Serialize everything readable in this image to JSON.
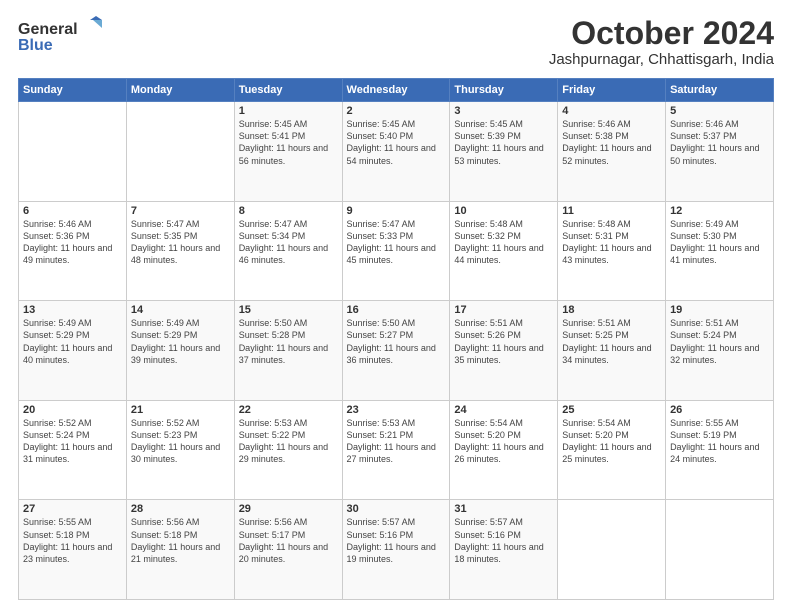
{
  "header": {
    "logo_line1": "General",
    "logo_line2": "Blue",
    "title": "October 2024",
    "subtitle": "Jashpurnagar, Chhattisgarh, India"
  },
  "days_of_week": [
    "Sunday",
    "Monday",
    "Tuesday",
    "Wednesday",
    "Thursday",
    "Friday",
    "Saturday"
  ],
  "weeks": [
    [
      {
        "day": "",
        "info": ""
      },
      {
        "day": "",
        "info": ""
      },
      {
        "day": "1",
        "info": "Sunrise: 5:45 AM\nSunset: 5:41 PM\nDaylight: 11 hours and 56 minutes."
      },
      {
        "day": "2",
        "info": "Sunrise: 5:45 AM\nSunset: 5:40 PM\nDaylight: 11 hours and 54 minutes."
      },
      {
        "day": "3",
        "info": "Sunrise: 5:45 AM\nSunset: 5:39 PM\nDaylight: 11 hours and 53 minutes."
      },
      {
        "day": "4",
        "info": "Sunrise: 5:46 AM\nSunset: 5:38 PM\nDaylight: 11 hours and 52 minutes."
      },
      {
        "day": "5",
        "info": "Sunrise: 5:46 AM\nSunset: 5:37 PM\nDaylight: 11 hours and 50 minutes."
      }
    ],
    [
      {
        "day": "6",
        "info": "Sunrise: 5:46 AM\nSunset: 5:36 PM\nDaylight: 11 hours and 49 minutes."
      },
      {
        "day": "7",
        "info": "Sunrise: 5:47 AM\nSunset: 5:35 PM\nDaylight: 11 hours and 48 minutes."
      },
      {
        "day": "8",
        "info": "Sunrise: 5:47 AM\nSunset: 5:34 PM\nDaylight: 11 hours and 46 minutes."
      },
      {
        "day": "9",
        "info": "Sunrise: 5:47 AM\nSunset: 5:33 PM\nDaylight: 11 hours and 45 minutes."
      },
      {
        "day": "10",
        "info": "Sunrise: 5:48 AM\nSunset: 5:32 PM\nDaylight: 11 hours and 44 minutes."
      },
      {
        "day": "11",
        "info": "Sunrise: 5:48 AM\nSunset: 5:31 PM\nDaylight: 11 hours and 43 minutes."
      },
      {
        "day": "12",
        "info": "Sunrise: 5:49 AM\nSunset: 5:30 PM\nDaylight: 11 hours and 41 minutes."
      }
    ],
    [
      {
        "day": "13",
        "info": "Sunrise: 5:49 AM\nSunset: 5:29 PM\nDaylight: 11 hours and 40 minutes."
      },
      {
        "day": "14",
        "info": "Sunrise: 5:49 AM\nSunset: 5:29 PM\nDaylight: 11 hours and 39 minutes."
      },
      {
        "day": "15",
        "info": "Sunrise: 5:50 AM\nSunset: 5:28 PM\nDaylight: 11 hours and 37 minutes."
      },
      {
        "day": "16",
        "info": "Sunrise: 5:50 AM\nSunset: 5:27 PM\nDaylight: 11 hours and 36 minutes."
      },
      {
        "day": "17",
        "info": "Sunrise: 5:51 AM\nSunset: 5:26 PM\nDaylight: 11 hours and 35 minutes."
      },
      {
        "day": "18",
        "info": "Sunrise: 5:51 AM\nSunset: 5:25 PM\nDaylight: 11 hours and 34 minutes."
      },
      {
        "day": "19",
        "info": "Sunrise: 5:51 AM\nSunset: 5:24 PM\nDaylight: 11 hours and 32 minutes."
      }
    ],
    [
      {
        "day": "20",
        "info": "Sunrise: 5:52 AM\nSunset: 5:24 PM\nDaylight: 11 hours and 31 minutes."
      },
      {
        "day": "21",
        "info": "Sunrise: 5:52 AM\nSunset: 5:23 PM\nDaylight: 11 hours and 30 minutes."
      },
      {
        "day": "22",
        "info": "Sunrise: 5:53 AM\nSunset: 5:22 PM\nDaylight: 11 hours and 29 minutes."
      },
      {
        "day": "23",
        "info": "Sunrise: 5:53 AM\nSunset: 5:21 PM\nDaylight: 11 hours and 27 minutes."
      },
      {
        "day": "24",
        "info": "Sunrise: 5:54 AM\nSunset: 5:20 PM\nDaylight: 11 hours and 26 minutes."
      },
      {
        "day": "25",
        "info": "Sunrise: 5:54 AM\nSunset: 5:20 PM\nDaylight: 11 hours and 25 minutes."
      },
      {
        "day": "26",
        "info": "Sunrise: 5:55 AM\nSunset: 5:19 PM\nDaylight: 11 hours and 24 minutes."
      }
    ],
    [
      {
        "day": "27",
        "info": "Sunrise: 5:55 AM\nSunset: 5:18 PM\nDaylight: 11 hours and 23 minutes."
      },
      {
        "day": "28",
        "info": "Sunrise: 5:56 AM\nSunset: 5:18 PM\nDaylight: 11 hours and 21 minutes."
      },
      {
        "day": "29",
        "info": "Sunrise: 5:56 AM\nSunset: 5:17 PM\nDaylight: 11 hours and 20 minutes."
      },
      {
        "day": "30",
        "info": "Sunrise: 5:57 AM\nSunset: 5:16 PM\nDaylight: 11 hours and 19 minutes."
      },
      {
        "day": "31",
        "info": "Sunrise: 5:57 AM\nSunset: 5:16 PM\nDaylight: 11 hours and 18 minutes."
      },
      {
        "day": "",
        "info": ""
      },
      {
        "day": "",
        "info": ""
      }
    ]
  ]
}
